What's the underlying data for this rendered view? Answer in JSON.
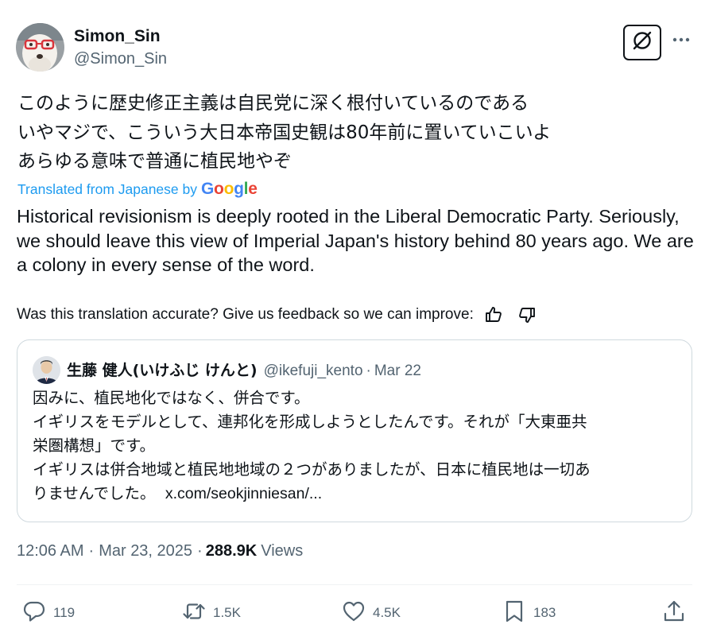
{
  "author": {
    "display_name": "Simon_Sin",
    "handle": "@Simon_Sin"
  },
  "tweet": {
    "original_lines": [
      "このように歴史修正主義は自民党に深く根付いているのである",
      "いやマジで、こういう大日本帝国史観は80年前に置いていこいよ",
      "あらゆる意味で普通に植民地やぞ"
    ],
    "translated_from": "Translated from Japanese by",
    "translator_brand": "Google",
    "translation": "Historical revisionism is deeply rooted in the Liberal Democratic Party. Seriously, we should leave this view of Imperial Japan's history behind 80 years ago. We are a colony in every sense of the word.",
    "feedback_prompt": "Was this translation accurate? Give us feedback so we can improve:"
  },
  "quote": {
    "name": "生藤 健人(いけふじ けんと)",
    "handle": "@ikefuji_kento",
    "separator": "·",
    "date": "Mar 22",
    "lines": [
      "因みに、植民地化ではなく、併合です。",
      "イギリスをモデルとして、連邦化を形成しようとしたんです。それが「大東亜共",
      "栄圏構想」です。",
      "イギリスは併合地域と植民地地域の２つがありましたが、日本に植民地は一切あ"
    ],
    "last_line_text": "りませんでした。",
    "link": "x.com/seokjinniesan/..."
  },
  "meta": {
    "time": "12:06 AM",
    "separator": "·",
    "date": "Mar 23, 2025",
    "views_separator": "·",
    "views_count": "288.9K",
    "views_label": "Views"
  },
  "actions": {
    "replies": "119",
    "reposts": "1.5K",
    "likes": "4.5K",
    "bookmarks": "183"
  },
  "icons": {
    "grok": "grok-slash-circle-icon",
    "more": "more-dots-icon",
    "thumbs_up": "thumbs-up-icon",
    "thumbs_down": "thumbs-down-icon",
    "reply": "reply-bubble-icon",
    "repost": "repost-arrows-icon",
    "like": "heart-icon",
    "bookmark": "bookmark-icon",
    "share": "share-upload-icon"
  },
  "colors": {
    "text_primary": "#0f1419",
    "text_secondary": "#536471",
    "link_blue": "#1d9bf0",
    "border": "#cfd9de",
    "google_blue": "#4285f4",
    "google_red": "#ea4335",
    "google_yellow": "#fbbc05",
    "google_green": "#34a853"
  }
}
